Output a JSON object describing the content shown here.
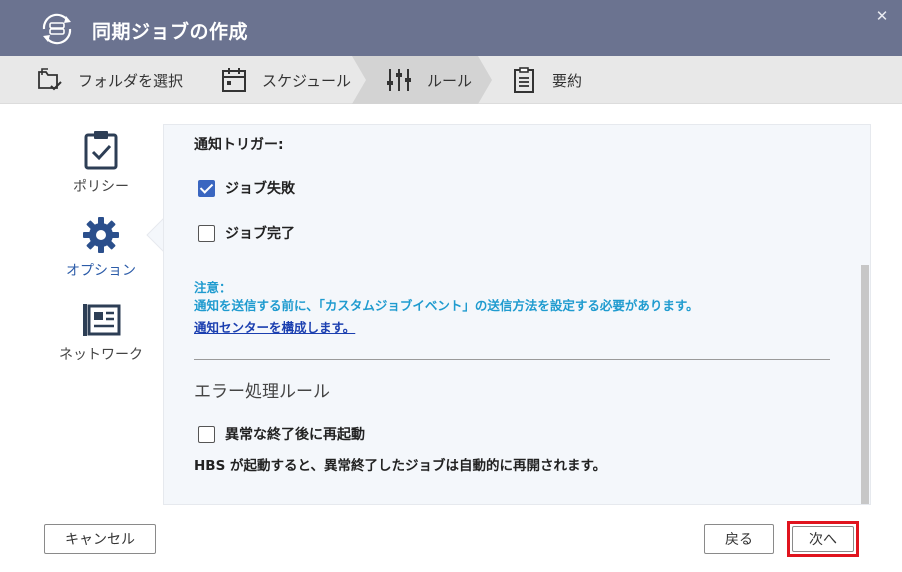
{
  "window": {
    "title": "同期ジョブの作成",
    "close_label": "✕"
  },
  "steps": [
    {
      "label": "フォルダを選択",
      "icon": "folder-select-icon",
      "active": false
    },
    {
      "label": "スケジュール",
      "icon": "calendar-icon",
      "active": false
    },
    {
      "label": "ルール",
      "icon": "sliders-icon",
      "active": true
    },
    {
      "label": "要約",
      "icon": "summary-clipboard-icon",
      "active": false
    }
  ],
  "nav": [
    {
      "label": "ポリシー",
      "icon": "clipboard-check-icon",
      "active": false
    },
    {
      "label": "オプション",
      "icon": "gear-icon",
      "active": true
    },
    {
      "label": "ネットワーク",
      "icon": "network-card-icon",
      "active": false
    }
  ],
  "content": {
    "trigger_label": "通知トリガー:",
    "job_failed": {
      "label": "ジョブ失敗",
      "checked": true
    },
    "job_completed": {
      "label": "ジョブ完了",
      "checked": false
    },
    "note_title": "注意：",
    "note_text": "通知を送信する前に、「カスタムジョブイベント」の送信方法を設定する必要があります。",
    "note_link": "通知センターを構成します。",
    "error_section_title": "エラー処理ルール",
    "restart_after_abnormal": {
      "label": "異常な終了後に再起動",
      "checked": false
    },
    "restart_desc": "HBS が起動すると、異常終了したジョブは自動的に再開されます。"
  },
  "buttons": {
    "cancel": "キャンセル",
    "back": "戻る",
    "next": "次へ"
  },
  "colors": {
    "titlebar": "#6b7390",
    "accent": "#3a66c0",
    "note": "#1f9bcf",
    "link": "#1b3fb0",
    "highlight": "#e0141e"
  }
}
